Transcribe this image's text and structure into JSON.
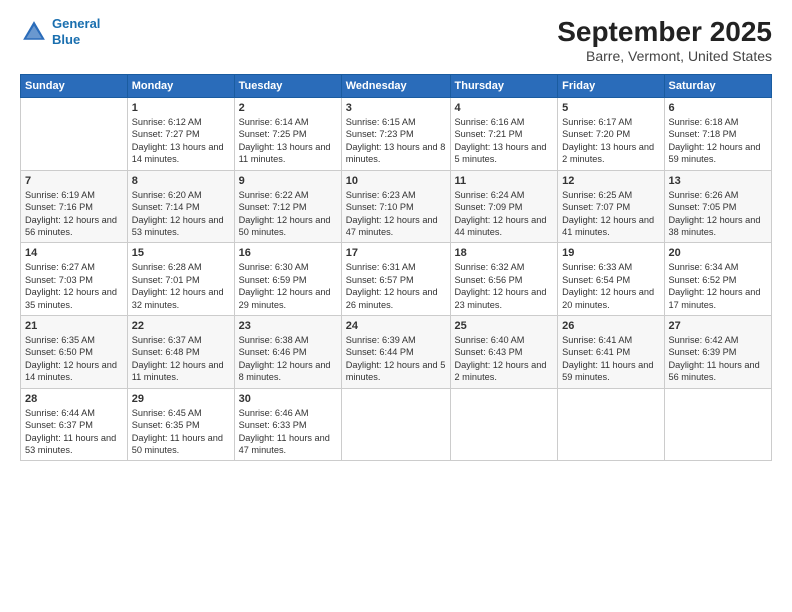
{
  "logo": {
    "line1": "General",
    "line2": "Blue"
  },
  "title": "September 2025",
  "subtitle": "Barre, Vermont, United States",
  "days_of_week": [
    "Sunday",
    "Monday",
    "Tuesday",
    "Wednesday",
    "Thursday",
    "Friday",
    "Saturday"
  ],
  "weeks": [
    [
      {
        "num": "",
        "sunrise": "",
        "sunset": "",
        "daylight": ""
      },
      {
        "num": "1",
        "sunrise": "Sunrise: 6:12 AM",
        "sunset": "Sunset: 7:27 PM",
        "daylight": "Daylight: 13 hours and 14 minutes."
      },
      {
        "num": "2",
        "sunrise": "Sunrise: 6:14 AM",
        "sunset": "Sunset: 7:25 PM",
        "daylight": "Daylight: 13 hours and 11 minutes."
      },
      {
        "num": "3",
        "sunrise": "Sunrise: 6:15 AM",
        "sunset": "Sunset: 7:23 PM",
        "daylight": "Daylight: 13 hours and 8 minutes."
      },
      {
        "num": "4",
        "sunrise": "Sunrise: 6:16 AM",
        "sunset": "Sunset: 7:21 PM",
        "daylight": "Daylight: 13 hours and 5 minutes."
      },
      {
        "num": "5",
        "sunrise": "Sunrise: 6:17 AM",
        "sunset": "Sunset: 7:20 PM",
        "daylight": "Daylight: 13 hours and 2 minutes."
      },
      {
        "num": "6",
        "sunrise": "Sunrise: 6:18 AM",
        "sunset": "Sunset: 7:18 PM",
        "daylight": "Daylight: 12 hours and 59 minutes."
      }
    ],
    [
      {
        "num": "7",
        "sunrise": "Sunrise: 6:19 AM",
        "sunset": "Sunset: 7:16 PM",
        "daylight": "Daylight: 12 hours and 56 minutes."
      },
      {
        "num": "8",
        "sunrise": "Sunrise: 6:20 AM",
        "sunset": "Sunset: 7:14 PM",
        "daylight": "Daylight: 12 hours and 53 minutes."
      },
      {
        "num": "9",
        "sunrise": "Sunrise: 6:22 AM",
        "sunset": "Sunset: 7:12 PM",
        "daylight": "Daylight: 12 hours and 50 minutes."
      },
      {
        "num": "10",
        "sunrise": "Sunrise: 6:23 AM",
        "sunset": "Sunset: 7:10 PM",
        "daylight": "Daylight: 12 hours and 47 minutes."
      },
      {
        "num": "11",
        "sunrise": "Sunrise: 6:24 AM",
        "sunset": "Sunset: 7:09 PM",
        "daylight": "Daylight: 12 hours and 44 minutes."
      },
      {
        "num": "12",
        "sunrise": "Sunrise: 6:25 AM",
        "sunset": "Sunset: 7:07 PM",
        "daylight": "Daylight: 12 hours and 41 minutes."
      },
      {
        "num": "13",
        "sunrise": "Sunrise: 6:26 AM",
        "sunset": "Sunset: 7:05 PM",
        "daylight": "Daylight: 12 hours and 38 minutes."
      }
    ],
    [
      {
        "num": "14",
        "sunrise": "Sunrise: 6:27 AM",
        "sunset": "Sunset: 7:03 PM",
        "daylight": "Daylight: 12 hours and 35 minutes."
      },
      {
        "num": "15",
        "sunrise": "Sunrise: 6:28 AM",
        "sunset": "Sunset: 7:01 PM",
        "daylight": "Daylight: 12 hours and 32 minutes."
      },
      {
        "num": "16",
        "sunrise": "Sunrise: 6:30 AM",
        "sunset": "Sunset: 6:59 PM",
        "daylight": "Daylight: 12 hours and 29 minutes."
      },
      {
        "num": "17",
        "sunrise": "Sunrise: 6:31 AM",
        "sunset": "Sunset: 6:57 PM",
        "daylight": "Daylight: 12 hours and 26 minutes."
      },
      {
        "num": "18",
        "sunrise": "Sunrise: 6:32 AM",
        "sunset": "Sunset: 6:56 PM",
        "daylight": "Daylight: 12 hours and 23 minutes."
      },
      {
        "num": "19",
        "sunrise": "Sunrise: 6:33 AM",
        "sunset": "Sunset: 6:54 PM",
        "daylight": "Daylight: 12 hours and 20 minutes."
      },
      {
        "num": "20",
        "sunrise": "Sunrise: 6:34 AM",
        "sunset": "Sunset: 6:52 PM",
        "daylight": "Daylight: 12 hours and 17 minutes."
      }
    ],
    [
      {
        "num": "21",
        "sunrise": "Sunrise: 6:35 AM",
        "sunset": "Sunset: 6:50 PM",
        "daylight": "Daylight: 12 hours and 14 minutes."
      },
      {
        "num": "22",
        "sunrise": "Sunrise: 6:37 AM",
        "sunset": "Sunset: 6:48 PM",
        "daylight": "Daylight: 12 hours and 11 minutes."
      },
      {
        "num": "23",
        "sunrise": "Sunrise: 6:38 AM",
        "sunset": "Sunset: 6:46 PM",
        "daylight": "Daylight: 12 hours and 8 minutes."
      },
      {
        "num": "24",
        "sunrise": "Sunrise: 6:39 AM",
        "sunset": "Sunset: 6:44 PM",
        "daylight": "Daylight: 12 hours and 5 minutes."
      },
      {
        "num": "25",
        "sunrise": "Sunrise: 6:40 AM",
        "sunset": "Sunset: 6:43 PM",
        "daylight": "Daylight: 12 hours and 2 minutes."
      },
      {
        "num": "26",
        "sunrise": "Sunrise: 6:41 AM",
        "sunset": "Sunset: 6:41 PM",
        "daylight": "Daylight: 11 hours and 59 minutes."
      },
      {
        "num": "27",
        "sunrise": "Sunrise: 6:42 AM",
        "sunset": "Sunset: 6:39 PM",
        "daylight": "Daylight: 11 hours and 56 minutes."
      }
    ],
    [
      {
        "num": "28",
        "sunrise": "Sunrise: 6:44 AM",
        "sunset": "Sunset: 6:37 PM",
        "daylight": "Daylight: 11 hours and 53 minutes."
      },
      {
        "num": "29",
        "sunrise": "Sunrise: 6:45 AM",
        "sunset": "Sunset: 6:35 PM",
        "daylight": "Daylight: 11 hours and 50 minutes."
      },
      {
        "num": "30",
        "sunrise": "Sunrise: 6:46 AM",
        "sunset": "Sunset: 6:33 PM",
        "daylight": "Daylight: 11 hours and 47 minutes."
      },
      {
        "num": "",
        "sunrise": "",
        "sunset": "",
        "daylight": ""
      },
      {
        "num": "",
        "sunrise": "",
        "sunset": "",
        "daylight": ""
      },
      {
        "num": "",
        "sunrise": "",
        "sunset": "",
        "daylight": ""
      },
      {
        "num": "",
        "sunrise": "",
        "sunset": "",
        "daylight": ""
      }
    ]
  ]
}
